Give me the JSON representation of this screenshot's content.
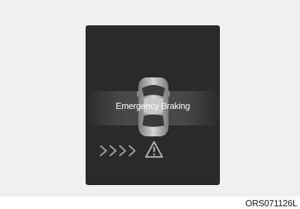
{
  "display": {
    "message": "Emergency Braking",
    "car_icon": "car-top-view-icon",
    "chevrons_icon": "chevron-right-icon",
    "warning_icon": "warning-triangle-icon"
  },
  "figure_code": "ORS071126L",
  "colors": {
    "background": "#f0f0f0",
    "cluster": "#2b2b2b",
    "message_band": "#4a4a4a",
    "text": "#ffffff",
    "icon_gray": "#9a9a9a"
  }
}
